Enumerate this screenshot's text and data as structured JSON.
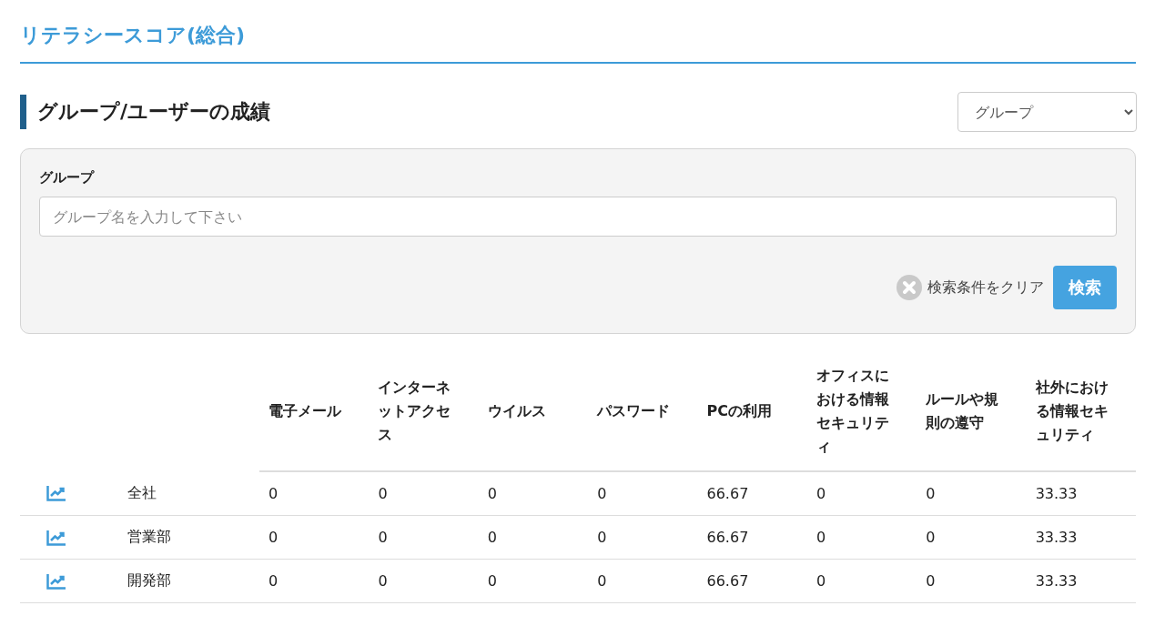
{
  "page_title": "リテラシースコア(総合)",
  "section_title": "グループ/ユーザーの成績",
  "view_select": {
    "value": "グループ"
  },
  "filter": {
    "label": "グループ",
    "placeholder": "グループ名を入力して下さい",
    "clear_label": "検索条件をクリア",
    "search_label": "検索"
  },
  "table": {
    "columns": [
      "電子メール",
      "インターネットアクセス",
      "ウイルス",
      "パスワード",
      "PCの利用",
      "オフィスにおける情報セキュリティ",
      "ルールや規則の遵守",
      "社外における情報セキュリティ"
    ],
    "rows": [
      {
        "name": "全社",
        "values": [
          "0",
          "0",
          "0",
          "0",
          "66.67",
          "0",
          "0",
          "33.33"
        ]
      },
      {
        "name": "営業部",
        "values": [
          "0",
          "0",
          "0",
          "0",
          "66.67",
          "0",
          "0",
          "33.33"
        ]
      },
      {
        "name": "開発部",
        "values": [
          "0",
          "0",
          "0",
          "0",
          "66.67",
          "0",
          "0",
          "33.33"
        ]
      }
    ]
  }
}
